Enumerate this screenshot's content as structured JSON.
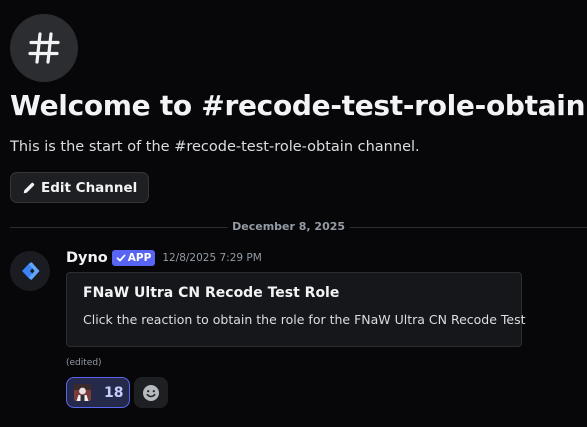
{
  "channel": {
    "icon": "hashtag-icon",
    "welcome_title": "Welcome to #recode-test-role-obtain!",
    "welcome_subtitle": "This is the start of the #recode-test-role-obtain channel.",
    "edit_button_label": "Edit Channel",
    "edit_button_icon": "pencil-icon"
  },
  "divider": {
    "date": "December 8, 2025"
  },
  "message": {
    "author": "Dyno",
    "avatar_icon": "dyno-logo-icon",
    "app_tag": "APP",
    "app_tag_icon": "checkmark-icon",
    "timestamp": "12/8/2025 7:29 PM",
    "embed": {
      "title": "FNaW Ultra CN Recode Test Role",
      "description": "Click the reaction to obtain the role for the FNaW Ultra CN Recode Test"
    },
    "edited_label": "(edited)",
    "reactions": [
      {
        "emoji_icon": "custom-character-emoji-icon",
        "count": "18",
        "active": true
      }
    ],
    "add_reaction_icon": "smiley-add-reaction-icon"
  },
  "colors": {
    "background": "#070709",
    "accent": "#5865f2",
    "reaction_active_bg": "#252a4b",
    "text_primary": "#f2f3f5",
    "text_muted": "#949ba4"
  }
}
